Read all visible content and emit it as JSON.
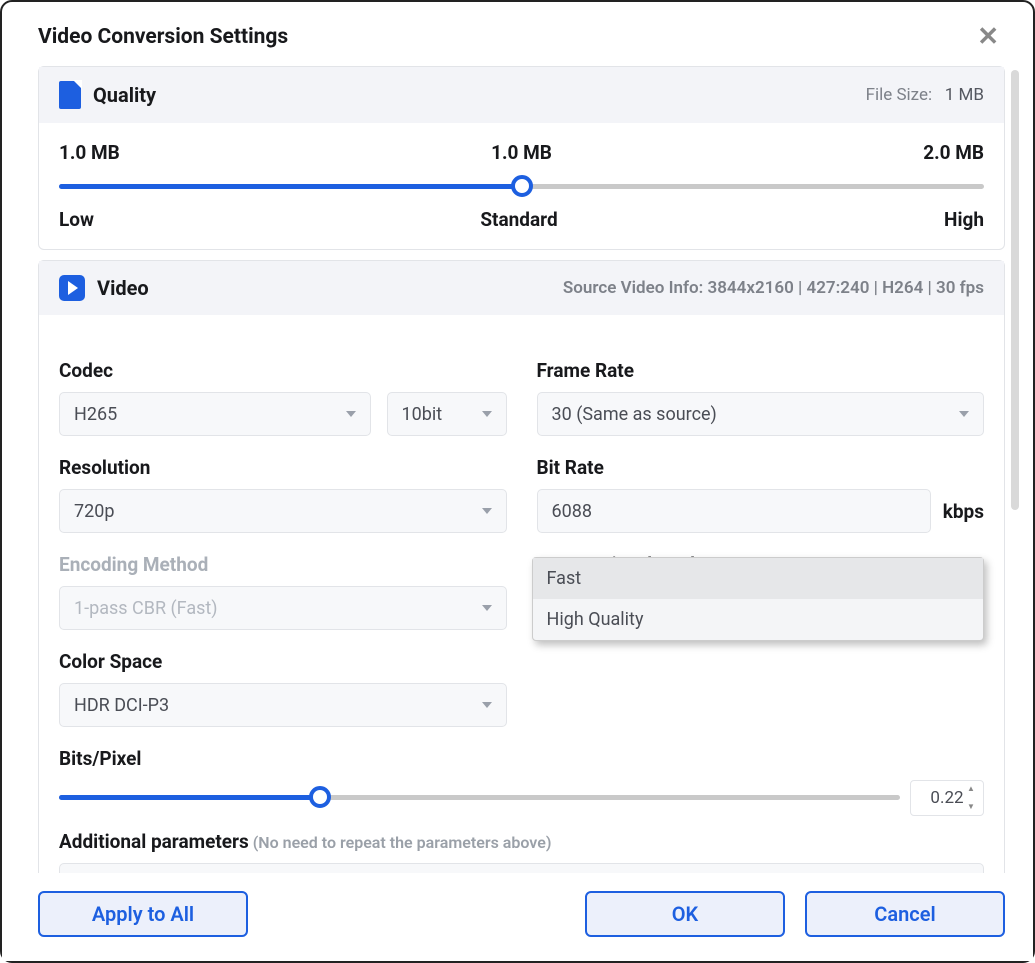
{
  "dialog": {
    "title": "Video Conversion Settings"
  },
  "quality": {
    "title": "Quality",
    "file_size_label": "File Size:",
    "file_size_value": "1 MB",
    "low_mb": "1.0 MB",
    "mid_mb": "1.0 MB",
    "high_mb": "2.0 MB",
    "low_label": "Low",
    "standard_label": "Standard",
    "high_label": "High",
    "slider_percent": 50
  },
  "video": {
    "title": "Video",
    "source_info": "Source Video Info: 3844x2160 | 427:240 | H264 | 30 fps",
    "codec_label": "Codec",
    "codec_value": "H265",
    "bitdepth_value": "10bit",
    "framerate_label": "Frame Rate",
    "framerate_value": "30 (Same as source)",
    "resolution_label": "Resolution",
    "resolution_value": "720p",
    "bitrate_label": "Bit Rate",
    "bitrate_value": "6088",
    "bitrate_unit": "kbps",
    "encoding_label": "Encoding Method",
    "encoding_value": "1-pass CBR (Fast)",
    "ovm_label": "Output Visual Mode",
    "ovm_value": "Fast",
    "ovm_options": {
      "fast": "Fast",
      "hq": "High Quality"
    },
    "colorspace_label": "Color Space",
    "colorspace_value": "HDR DCI-P3",
    "bpp_label": "Bits/Pixel",
    "bpp_value": "0.22",
    "bpp_slider_percent": 31,
    "addl_label": "Additional parameters",
    "addl_hint": "(No need to repeat the parameters above)"
  },
  "buttons": {
    "apply_all": "Apply to All",
    "ok": "OK",
    "cancel": "Cancel"
  }
}
